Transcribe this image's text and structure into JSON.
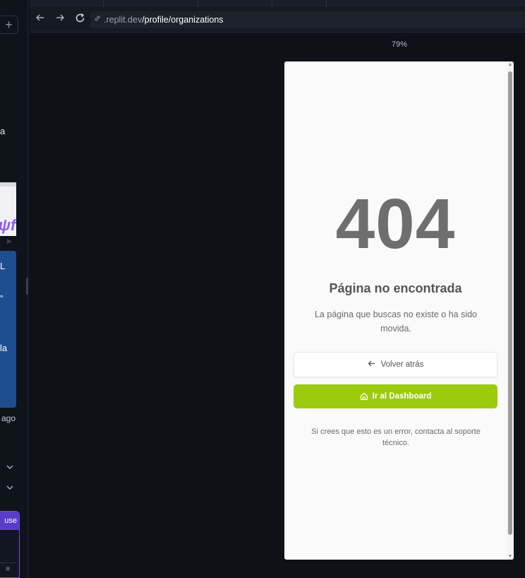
{
  "sidebar": {
    "add_label": "+",
    "fragments": [
      "a",
      "L",
      "”",
      "la",
      "ago"
    ],
    "logo_fragment": "ψfo",
    "use_button": "use"
  },
  "browser": {
    "back_icon": "arrow-left-icon",
    "forward_icon": "arrow-right-icon",
    "reload_icon": "reload-icon",
    "url_host": ".replit.dev",
    "url_path": "/profile/organizations"
  },
  "preview": {
    "zoom": "79%"
  },
  "page": {
    "code": "404",
    "title": "Página no encontrada",
    "description": "La página que buscas no existe o ha sido movida.",
    "back_button": "Volver atrás",
    "dashboard_button": "Ir al Dashboard",
    "note": "Si crees que esto es un error, contacta al soporte técnico.",
    "accent_color": "#9bcb0c"
  }
}
